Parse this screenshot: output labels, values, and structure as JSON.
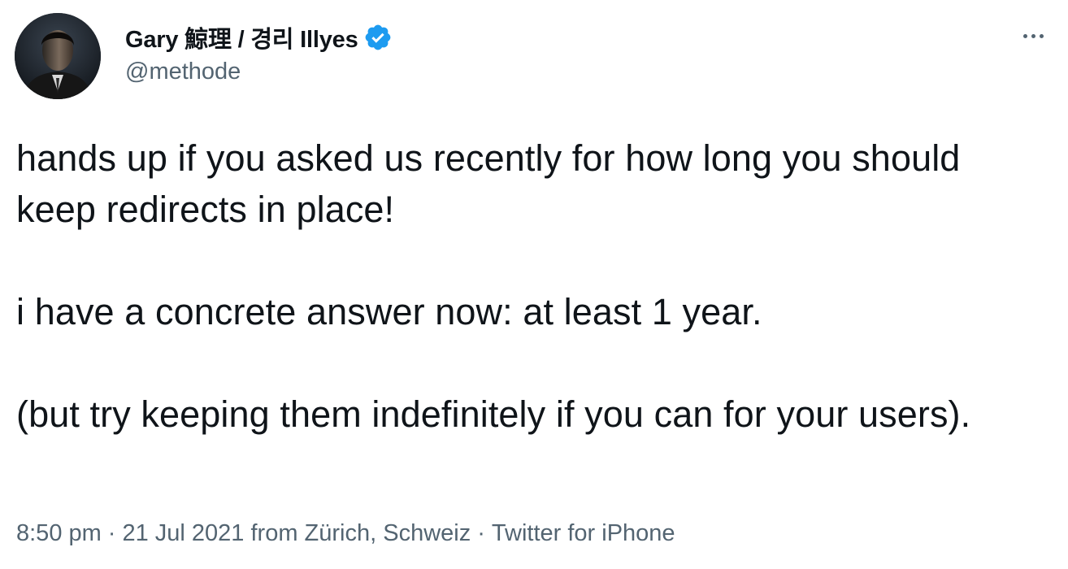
{
  "author": {
    "display_name": "Gary 鯨理 / 경리 Illyes",
    "handle": "@methode",
    "verified": true
  },
  "tweet": {
    "paragraphs": [
      "hands up if you asked us recently for how long you should keep redirects in place!",
      "i have a concrete answer now: at least 1 year.",
      "(but try keeping them indefinitely if you can for your users)."
    ],
    "time": "8:50 pm",
    "date": "21 Jul 2021",
    "location": "from Zürich, Schweiz",
    "source": "Twitter for iPhone",
    "separator": "·"
  },
  "icons": {
    "verified": "verified-badge-icon",
    "more": "more-options-icon"
  },
  "colors": {
    "text": "#0f1419",
    "secondary": "#536471",
    "verified": "#1d9bf0"
  }
}
